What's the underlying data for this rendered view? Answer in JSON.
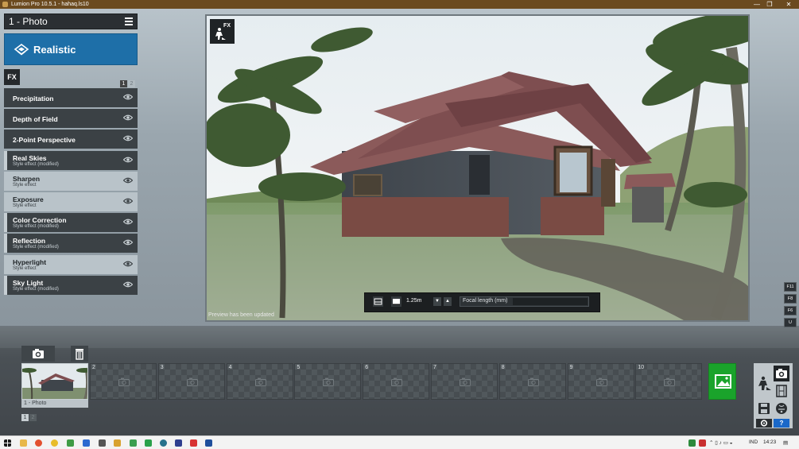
{
  "window": {
    "title": "Lumion Pro 10.5.1  - hahaq.ls10",
    "controls": [
      "—",
      "❐",
      "✕"
    ]
  },
  "panel": {
    "photo_title": "1 - Photo",
    "style_label": "Realistic",
    "fx_tab": "FX",
    "pages": [
      "1",
      "2"
    ],
    "effects": [
      {
        "name": "Precipitation",
        "sub": "",
        "shade": "dark",
        "modified": false
      },
      {
        "name": "Depth of Field",
        "sub": "",
        "shade": "dark",
        "modified": false
      },
      {
        "name": "2-Point Perspective",
        "sub": "",
        "shade": "dark",
        "modified": false
      },
      {
        "name": "Real Skies",
        "sub": "Style effect (modified)",
        "shade": "dark",
        "modified": true
      },
      {
        "name": "Sharpen",
        "sub": "Style effect",
        "shade": "light",
        "modified": false
      },
      {
        "name": "Exposure",
        "sub": "Style effect",
        "shade": "light",
        "modified": false
      },
      {
        "name": "Color Correction",
        "sub": "Style effect (modified)",
        "shade": "dark",
        "modified": true
      },
      {
        "name": "Reflection",
        "sub": "Style effect (modified)",
        "shade": "dark",
        "modified": true
      },
      {
        "name": "Hyperlight",
        "sub": "Style effect",
        "shade": "light",
        "modified": false
      },
      {
        "name": "Sky Light",
        "sub": "Style effect (modified)",
        "shade": "dark",
        "modified": true
      }
    ]
  },
  "viewport": {
    "fx_badge": "FX",
    "preview_note": "Preview has been updated",
    "camera_height": "1.25m",
    "focal_label": "Focal length (mm)"
  },
  "fkeys": [
    "F11",
    "F8",
    "F6",
    "U"
  ],
  "shelf": {
    "slots": [
      "1 - Photo",
      "2",
      "3",
      "4",
      "5",
      "6",
      "7",
      "8",
      "9",
      "10"
    ],
    "pages": [
      "1",
      "2"
    ]
  },
  "modes": {
    "help": "?"
  },
  "taskbar": {
    "language": "IND",
    "time": "14:23"
  },
  "colors": {
    "accent_blue": "#1e6fa8",
    "render_green": "#1aa32b",
    "titlebar": "#6b4a1f"
  }
}
